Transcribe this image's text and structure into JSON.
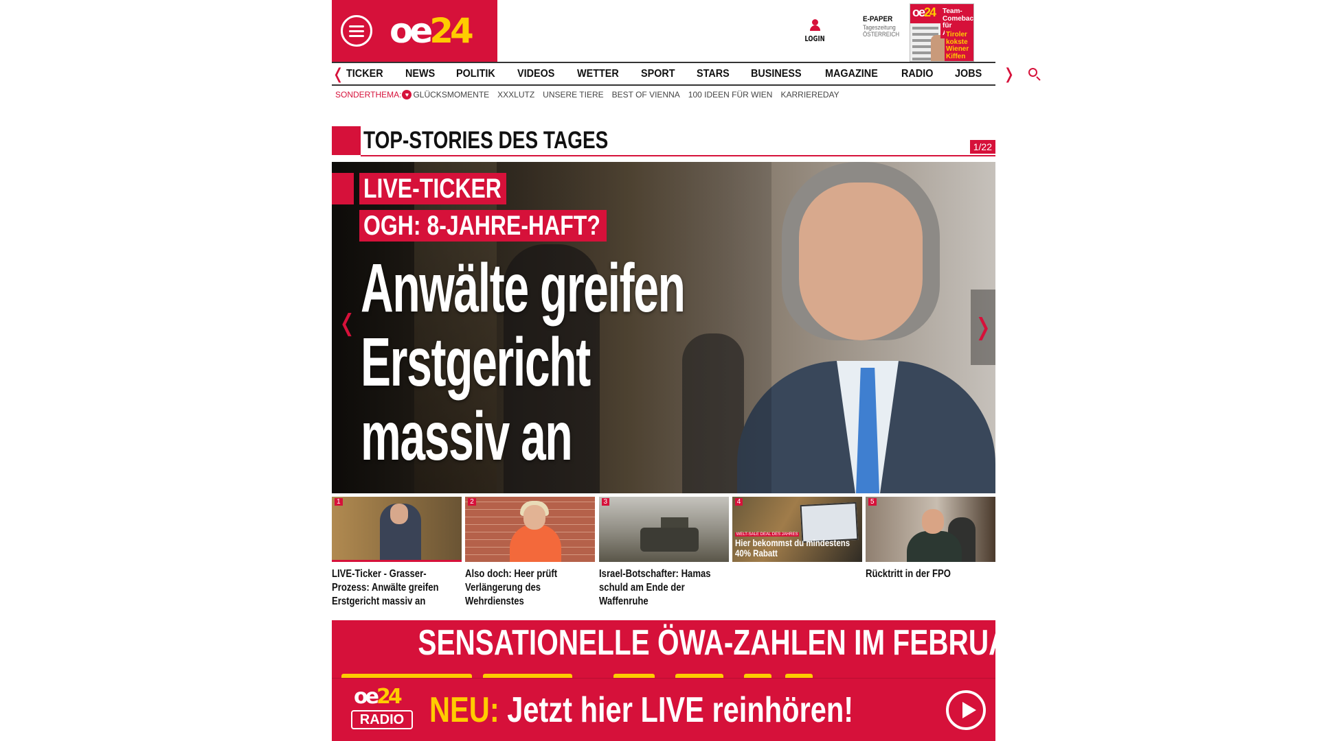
{
  "header": {
    "logo": {
      "oe": "oe",
      "num": "24"
    },
    "login_label": "LOGIN",
    "epaper": {
      "title": "E-PAPER",
      "line1": "Tageszeitung",
      "line2": "ÖSTERREICH"
    },
    "cover": {
      "mast_oe": "oe",
      "mast_num": "24",
      "headline_top": "Team-Comeback für ALABA",
      "headline_bottom": "Tiroler kokste Wiener Kiffen"
    }
  },
  "nav": {
    "items": [
      "TICKER",
      "NEWS",
      "POLITIK",
      "VIDEOS",
      "WETTER",
      "SPORT",
      "STARS",
      "BUSINESS",
      "MAGAZINE",
      "RADIO",
      "JOBS"
    ],
    "left_arrow": "❬",
    "right_arrow": "❭"
  },
  "subnav": {
    "label": "SONDERTHEMA:",
    "items": [
      "GLÜCKSMOMENTE",
      "XXXLUTZ",
      "UNSERE TIERE",
      "BEST OF VIENNA",
      "100 IDEEN FÜR WIEN",
      "KARRIEREDAY"
    ]
  },
  "section": {
    "title": "TOP-STORIES DES TAGES",
    "counter": "1/22"
  },
  "hero": {
    "kicker1": "LIVE-TICKER",
    "kicker2": "OGH: 8-JAHRE-HAFT?",
    "title_line1": "Anwälte greifen",
    "title_line2": "Erstgericht",
    "title_line3": "massiv an",
    "arrow_left": "❬",
    "arrow_right": "❭"
  },
  "thumbs": [
    {
      "num": "1",
      "caption": "LIVE-Ticker - Grasser-Prozess: Anwälte greifen Erstgericht massiv an"
    },
    {
      "num": "2",
      "caption": "Also doch: Heer prüft Verlängerung des Wehrdienstes"
    },
    {
      "num": "3",
      "caption": "Israel-Botschafter: Hamas schuld am Ende der Waffenruhe"
    },
    {
      "num": "4",
      "caption": "",
      "overlay_tag": "WELT-SALE DEAL DES JAHRES",
      "overlay_caption": "Hier bekommst du mindestens 40% Rabatt"
    },
    {
      "num": "5",
      "caption": "Rücktritt in der FPO"
    }
  ],
  "banner": {
    "headline": "SENSATIONELLE ÖWA-ZAHLEN IM FEBRUAR",
    "radio_logo_oe": "oe",
    "radio_logo_num": "24",
    "radio_logo_label": "RADIO",
    "neu": "NEU:",
    "live_text": "Jetzt hier LIVE reinhören!"
  },
  "colors": {
    "brand_red": "#d6113a",
    "brand_yellow": "#ffcc00",
    "text": "#111111"
  }
}
